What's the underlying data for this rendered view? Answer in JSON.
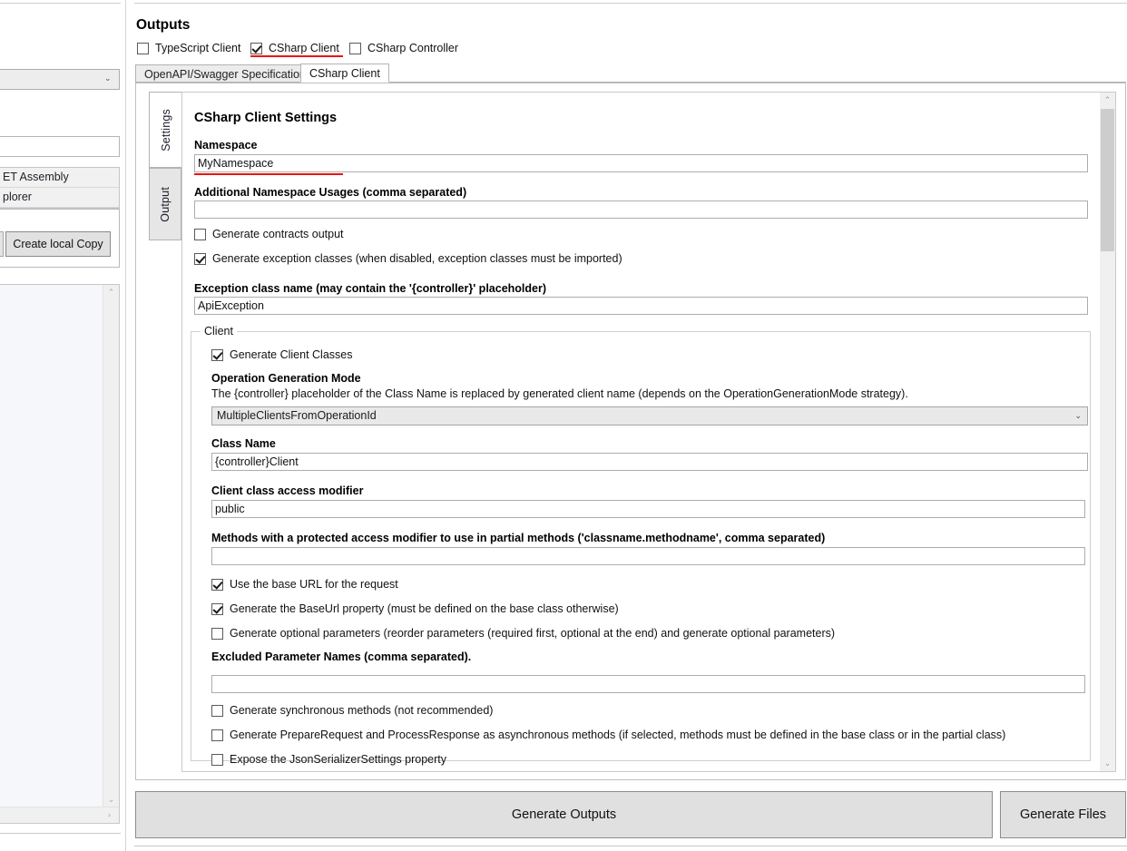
{
  "left_panel": {
    "combo_value": "",
    "text_value": "",
    "list_items": [
      {
        "label": "ET Assembly"
      },
      {
        "label": "plorer"
      }
    ],
    "create_local_copy_button": "Create local Copy"
  },
  "header": {
    "title": "Outputs",
    "output_checkboxes": [
      {
        "label": "TypeScript Client",
        "checked": false,
        "highlighted": false
      },
      {
        "label": "CSharp Client",
        "checked": true,
        "highlighted": true
      },
      {
        "label": "CSharp Controller",
        "checked": false,
        "highlighted": false
      }
    ]
  },
  "tabs": [
    {
      "label": "OpenAPI/Swagger Specification",
      "active": false
    },
    {
      "label": "CSharp Client",
      "active": true
    }
  ],
  "vertical_tabs": [
    {
      "label": "Settings",
      "active": true
    },
    {
      "label": "Output",
      "active": false
    }
  ],
  "settings": {
    "heading": "CSharp Client Settings",
    "namespace_label": "Namespace",
    "namespace_value": "MyNamespace",
    "additional_namespace_label": "Additional Namespace Usages (comma separated)",
    "additional_namespace_value": "",
    "generate_contracts_output": "Generate contracts output",
    "generate_exception_classes": "Generate exception classes (when disabled, exception classes must be imported)",
    "exception_class_name_label": "Exception class name (may contain the '{controller}' placeholder)",
    "exception_class_name_value": "ApiException"
  },
  "client_group": {
    "title": "Client",
    "generate_client_classes": "Generate Client Classes",
    "operation_generation_mode_label": "Operation Generation Mode",
    "operation_generation_mode_description": "The {controller} placeholder of the Class Name is replaced by generated client name (depends on the OperationGenerationMode strategy).",
    "operation_generation_mode_value": "MultipleClientsFromOperationId",
    "class_name_label": "Class Name",
    "class_name_value": "{controller}Client",
    "access_modifier_label": "Client class access modifier",
    "access_modifier_value": "public",
    "protected_methods_label": "Methods with a protected access modifier to use in partial methods ('classname.methodname', comma separated)",
    "protected_methods_value": "",
    "use_base_url": "Use the base URL for the request",
    "generate_baseurl_property": "Generate the BaseUrl property (must be defined on the base class otherwise)",
    "generate_optional_parameters": "Generate optional parameters (reorder parameters (required first, optional at the end) and generate optional parameters)",
    "excluded_parameter_names_label": "Excluded Parameter Names (comma separated).",
    "excluded_parameter_names_value": "",
    "generate_synchronous_methods": "Generate synchronous methods (not recommended)",
    "generate_prepare_request": "Generate PrepareRequest and ProcessResponse as asynchronous methods (if selected, methods must be defined in the base class or in the partial class)",
    "expose_json_serializer": "Expose the JsonSerializerSettings property"
  },
  "footer": {
    "generate_outputs_button": "Generate Outputs",
    "generate_files_button": "Generate Files"
  },
  "icons": {
    "chevron_down": "⌄",
    "chevron_up": "⌃",
    "chevron_right": "›"
  },
  "colors": {
    "annotation_red": "#ee1111",
    "accent_gray": "#e0e0e0"
  }
}
